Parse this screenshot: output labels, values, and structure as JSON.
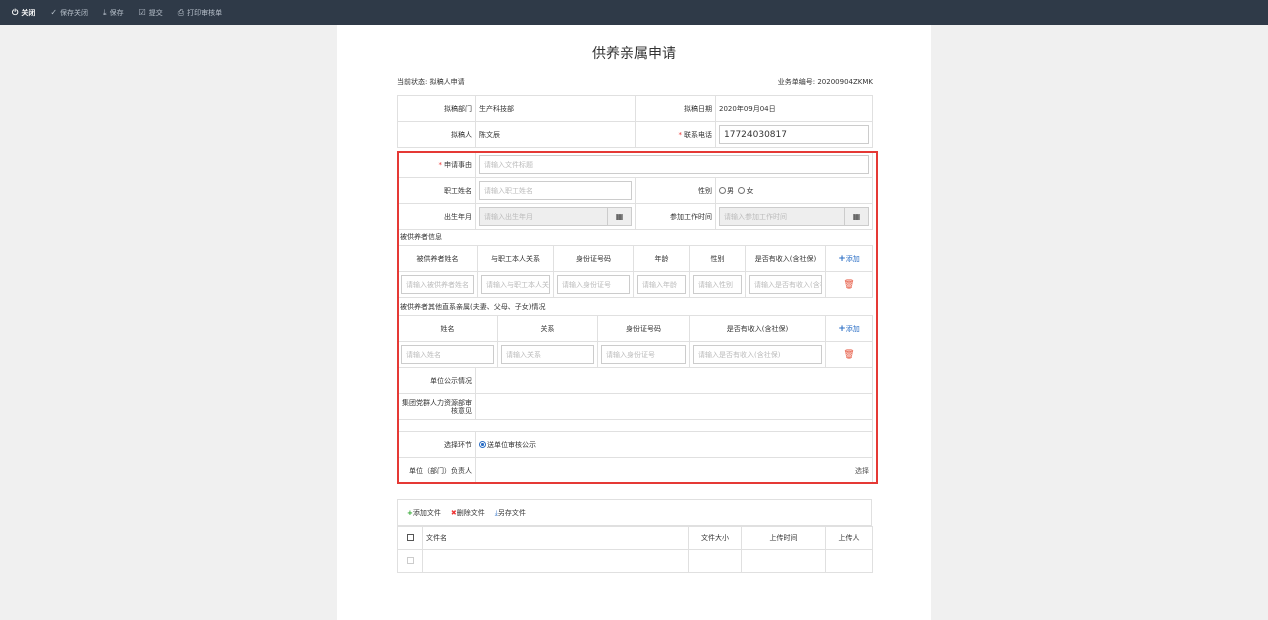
{
  "toolbar": {
    "close": "关闭",
    "save_close": "保存关闭",
    "save": "保存",
    "submit": "提交",
    "print": "打印审核单"
  },
  "page": {
    "title": "供养亲属申请",
    "status_label": "当前状态:",
    "status_value": "拟稿人申请",
    "doc_no_label": "业务单编号:",
    "doc_no_value": "20200904ZKMK"
  },
  "form": {
    "dept_label": "拟稿部门",
    "dept_value": "生产科技部",
    "date_label": "拟稿日期",
    "date_value": "2020年09月04日",
    "drafter_label": "拟稿人",
    "drafter_value": "陈文辰",
    "phone_label": "联系电话",
    "phone_value": "17724030817",
    "subject_label": "申请事由",
    "subject_placeholder": "请输入文件标题",
    "emp_name_label": "职工姓名",
    "emp_name_placeholder": "请输入职工姓名",
    "gender_label": "性别",
    "gender_male": "男",
    "gender_female": "女",
    "birth_label": "出生年月",
    "birth_placeholder": "请输入出生年月",
    "work_date_label": "参加工作时间",
    "work_date_placeholder": "请输入参加工作时间",
    "dependents_title": "被供养者信息",
    "dependents_headers": [
      "被供养者姓名",
      "与职工本人关系",
      "身份证号码",
      "年龄",
      "性别",
      "是否有收入(含社保)"
    ],
    "dependents_add": "添加",
    "dependents_placeholders": [
      "请输入被供养者姓名",
      "请输入与职工本人关系",
      "请输入身份证号",
      "请输入年龄",
      "请输入性别",
      "请输入是否有收入(含社保)"
    ],
    "others_title": "被供养者其他直系亲属(夫妻、父母、子女)情况",
    "others_headers": [
      "姓名",
      "关系",
      "身份证号码",
      "是否有收入(含社保)"
    ],
    "others_add": "添加",
    "others_placeholders": [
      "请输入姓名",
      "请输入关系",
      "请输入身份证号",
      "请输入是否有收入(含社保)"
    ],
    "public_label": "单位公示情况",
    "hr_opinion_label": "集团党群人力资源部审核意见",
    "process_label": "选择环节",
    "process_option": "送单位审核公示",
    "leader_label": "单位（部门）负责人",
    "select_link": "选择"
  },
  "attachments": {
    "add": "添加文件",
    "delete": "删除文件",
    "save_as": "另存文件",
    "headers": [
      "文件名",
      "文件大小",
      "上传时间",
      "上传人"
    ]
  }
}
